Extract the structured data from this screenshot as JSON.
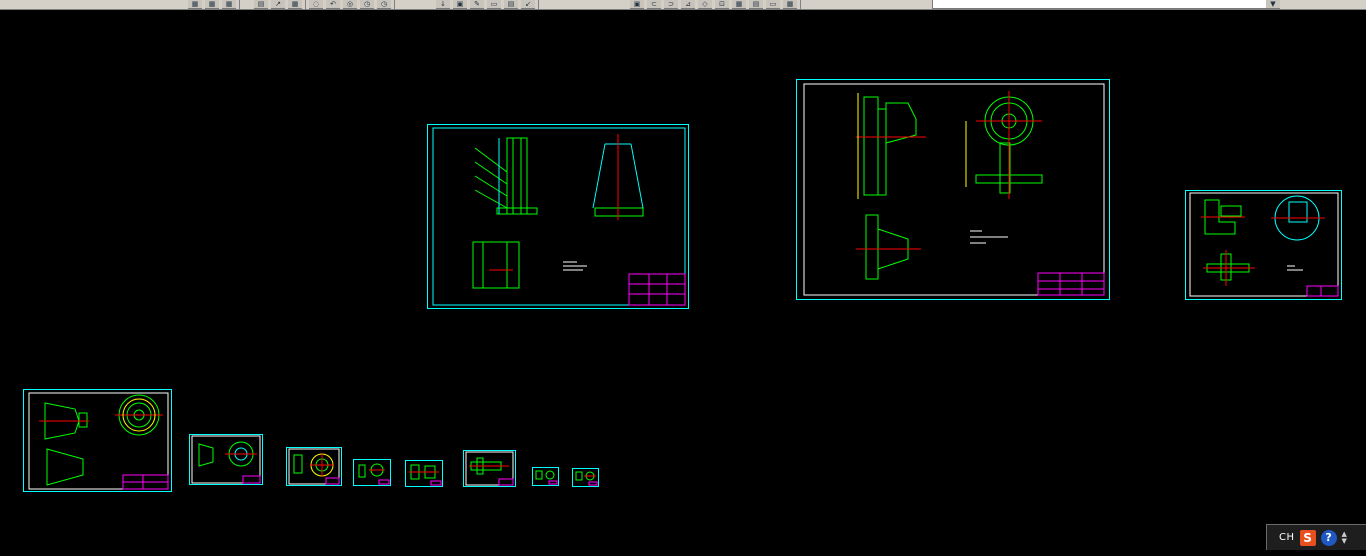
{
  "toolbar": {
    "groups": [
      {
        "buttons": [
          "▦",
          "▦",
          "▦"
        ]
      },
      {
        "buttons": [
          "▤",
          "↗",
          "▦",
          "◌",
          "↶",
          "◎",
          "◷",
          "◷"
        ]
      },
      {
        "buttons": [
          "↓",
          "▣",
          "✎",
          "▭",
          "▤",
          "↙"
        ]
      },
      {
        "buttons": [
          "▣",
          "⊂",
          "⊃",
          "⊿",
          "◇",
          "⊡",
          "▦",
          "▤",
          "▭",
          "▦"
        ]
      }
    ],
    "combo_value": "",
    "combo_arrow": "▼"
  },
  "ime": {
    "language": "CH",
    "logo_letter": "S",
    "help_glyph": "?",
    "arrow_up": "▲",
    "arrow_down": "▼"
  },
  "colors": {
    "background": "#000000",
    "frame": "#00ffff",
    "outline": "#00ff00",
    "centerline": "#ff0000",
    "title_block": "#ff00ff",
    "accent": "#ffff00",
    "text": "#ffffff"
  }
}
